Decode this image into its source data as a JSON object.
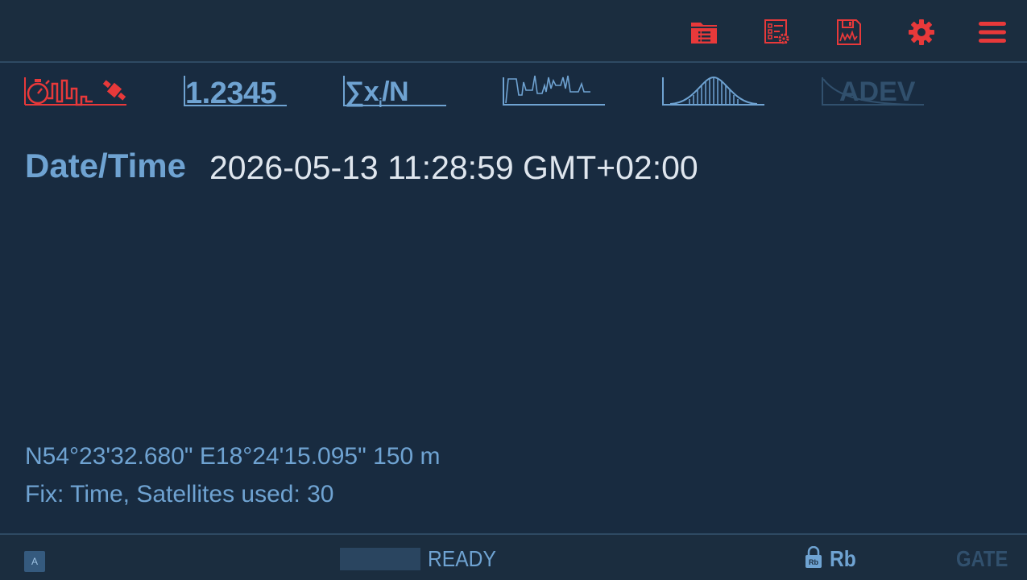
{
  "toolbar": {
    "icons": [
      "folder-list-icon",
      "report-settings-icon",
      "save-chart-icon",
      "gear-icon",
      "hamburger-menu-icon"
    ],
    "accent_color": "#e8393a"
  },
  "tabs": {
    "numeric_label": "1.2345",
    "stats_label": "∑x",
    "stats_sub": "i",
    "stats_tail": "/N",
    "adev_label": "ADEV",
    "active_color": "#e8393a",
    "inactive_color": "#6fa3d2",
    "disabled_color": "#31506d"
  },
  "main": {
    "datetime_label": "Date/Time",
    "datetime_value": "2026-05-13 11:28:59 GMT+02:00",
    "coordinates": "N54°23'32.680\" E18°24'15.095\" 150 m",
    "fix_info": "Fix: Time, Satellites used: 30"
  },
  "status": {
    "mode_badge": "A",
    "state": "READY",
    "lock_icon_text": "Rb",
    "reference": "Rb",
    "gate": "GATE"
  }
}
